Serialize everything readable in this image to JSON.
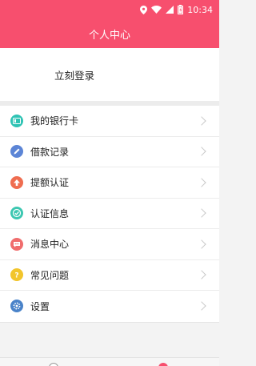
{
  "status_bar": {
    "time": "10:34",
    "icons": [
      "location-icon",
      "wifi-icon",
      "signal-icon",
      "battery-icon"
    ]
  },
  "header": {
    "title": "个人中心"
  },
  "login": {
    "label": "立刻登录"
  },
  "menu": {
    "items": [
      {
        "label": "我的银行卡",
        "icon": "bank-card-icon",
        "color": "#2fc3b4"
      },
      {
        "label": "借款记录",
        "icon": "pencil-icon",
        "color": "#5c85d6"
      },
      {
        "label": "提额认证",
        "icon": "arrow-up-icon",
        "color": "#ef6d50"
      },
      {
        "label": "认证信息",
        "icon": "check-icon",
        "color": "#3cc7b1"
      },
      {
        "label": "消息中心",
        "icon": "message-icon",
        "color": "#f06d6d"
      },
      {
        "label": "常见问题",
        "icon": "question-icon",
        "color": "#f2c52c"
      },
      {
        "label": "设置",
        "icon": "gear-icon",
        "color": "#4a83c9"
      }
    ]
  },
  "colors": {
    "brand": "#f74f6e"
  }
}
